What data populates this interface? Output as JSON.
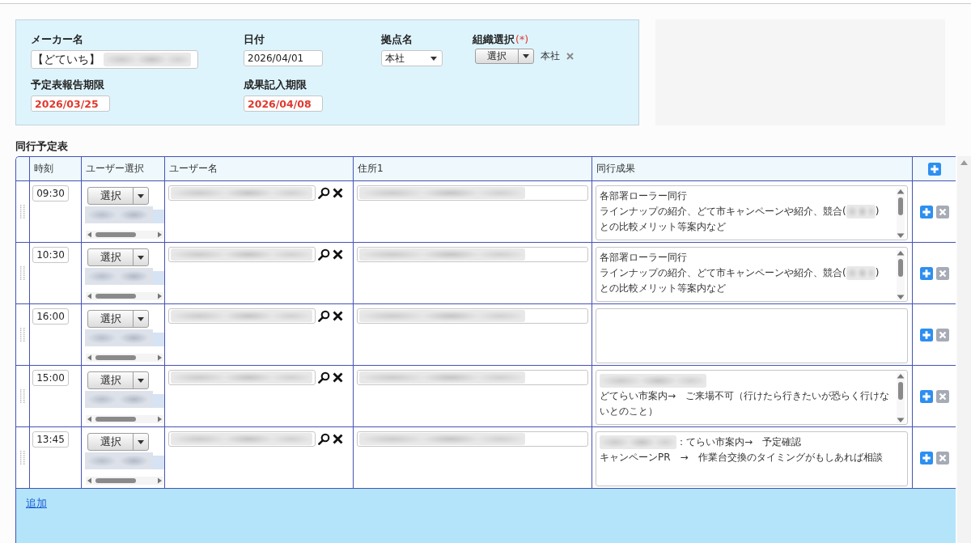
{
  "form": {
    "fields": [
      {
        "kind": "text",
        "label": "メーカー名",
        "value": "【どていち】",
        "blurred": true
      },
      {
        "kind": "date",
        "label": "日付",
        "value": "2026/04/01"
      },
      {
        "kind": "select",
        "label": "拠点名",
        "value": "本社"
      },
      {
        "kind": "picker",
        "label": "組織選択",
        "required_mark": "(*)",
        "button": "選択",
        "value": "本社"
      },
      {
        "kind": "deadline",
        "label": "予定表報告期限",
        "value": "2026/03/25"
      },
      {
        "kind": "deadline",
        "label": "成果記入期限",
        "value": "2026/04/08"
      }
    ]
  },
  "schedule": {
    "title": "同行予定表",
    "columns": [
      "時刻",
      "ユーザー選択",
      "ユーザー名",
      "住所1",
      "同行成果"
    ],
    "rows": [
      {
        "time": "09:30",
        "select_button": "選択",
        "users_blurred": true,
        "user_name_blurred": true,
        "address_blurred": true,
        "result": {
          "scrollable": true,
          "lines": [
            [
              {
                "kind": "text",
                "text": "各部署ローラー同行"
              }
            ],
            [
              {
                "kind": "text",
                "text": "ラインナップの紹介、どて市キャンペーンや紹介、競合("
              },
              {
                "kind": "blurred"
              },
              {
                "kind": "text",
                "text": ")"
              }
            ],
            [
              {
                "kind": "text",
                "text": "との比較メリット等案内など"
              }
            ]
          ]
        }
      },
      {
        "time": "10:30",
        "select_button": "選択",
        "users_blurred": true,
        "user_name_blurred": true,
        "address_blurred": true,
        "result": {
          "scrollable": true,
          "lines": [
            [
              {
                "kind": "text",
                "text": "各部署ローラー同行"
              }
            ],
            [
              {
                "kind": "text",
                "text": "ラインナップの紹介、どて市キャンペーンや紹介、競合("
              },
              {
                "kind": "blurred"
              },
              {
                "kind": "text",
                "text": ")"
              }
            ],
            [
              {
                "kind": "text",
                "text": "との比較メリット等案内など"
              }
            ]
          ]
        }
      },
      {
        "time": "16:00",
        "select_button": "選択",
        "users_blurred": true,
        "user_name_blurred": true,
        "address_blurred": true,
        "result": {
          "scrollable": false
        }
      },
      {
        "time": "15:00",
        "select_button": "選択",
        "users_blurred": true,
        "user_name_blurred": true,
        "address_blurred": true,
        "result": {
          "scrollable": true,
          "lines": [
            [
              {
                "kind": "blurred"
              }
            ],
            [
              {
                "kind": "text",
                "text": "どてらい市案内→　ご来場不可（行けたら行きたいが恐らく行けないとのこと）"
              }
            ]
          ]
        }
      },
      {
        "time": "13:45",
        "select_button": "選択",
        "users_blurred": true,
        "user_name_blurred": true,
        "address_blurred": true,
        "result": {
          "scrollable": false,
          "lines": [
            [
              {
                "kind": "blurred"
              },
              {
                "kind": "text",
                "text": "：てらい市案内→　予定確認"
              }
            ],
            [
              {
                "kind": "text",
                "text": "キャンペーンPR　→　作業台交換のタイミングがもしあれば相談"
              }
            ]
          ]
        }
      }
    ],
    "add_link": "追加"
  }
}
